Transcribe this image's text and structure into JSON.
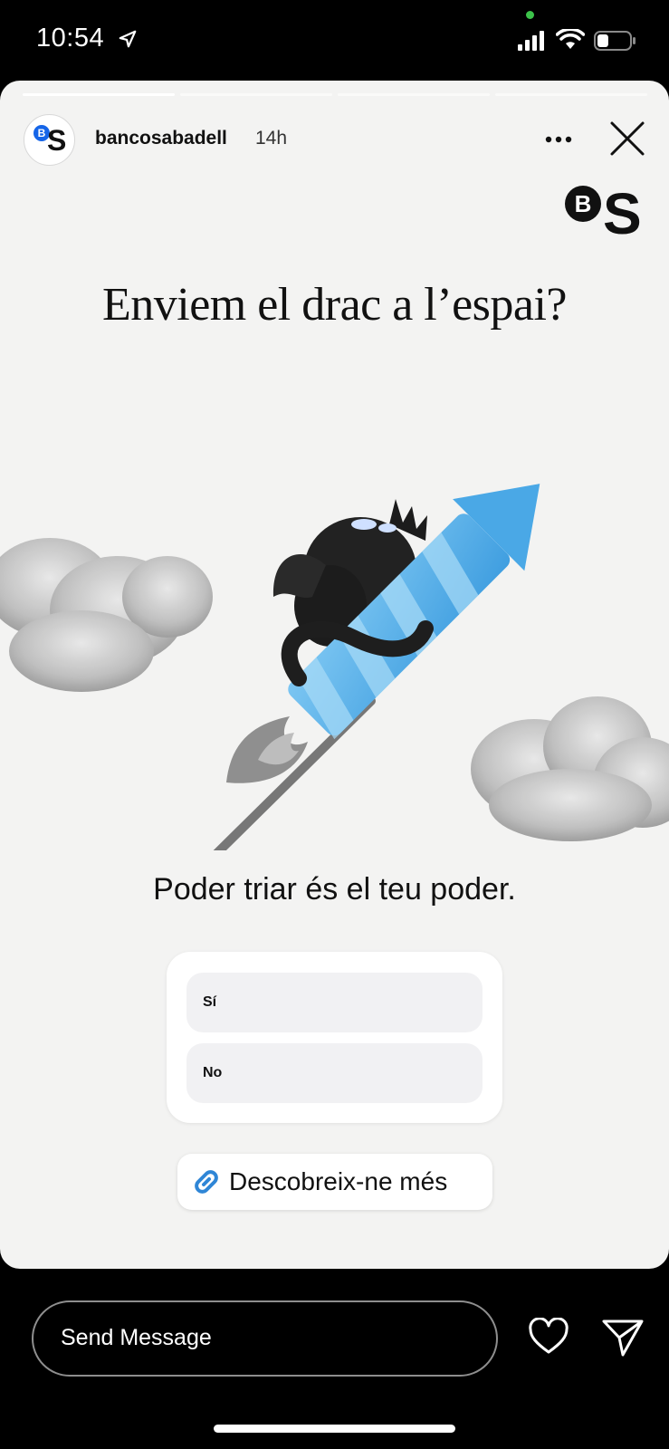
{
  "status_bar": {
    "time": "10:54",
    "icons": [
      "location-arrow-icon",
      "signal-icon",
      "wifi-icon",
      "battery-icon"
    ],
    "battery_level": 0.35
  },
  "story": {
    "progress_segments": 4,
    "active_segment": 0,
    "account": {
      "avatar_letters": [
        "B",
        "S"
      ],
      "username": "bancosabadell",
      "time_ago": "14h"
    },
    "brand_logo_letters": [
      "B",
      "S"
    ],
    "headline": "Enviem el drac a l’espai?",
    "tagline": "Poder triar és el teu poder.",
    "poll": {
      "options": [
        "Sí",
        "No"
      ]
    },
    "link_sticker": {
      "label": "Descobreix-ne més",
      "icon": "link-icon"
    }
  },
  "bottom_bar": {
    "message_placeholder": "Send Message",
    "icons": [
      "heart-icon",
      "send-icon"
    ]
  },
  "colors": {
    "brand_blue": "#1565e8",
    "rocket_blue": "#5ab3ea",
    "story_background": "#f3f3f2",
    "link_blue": "#2f86d6"
  }
}
